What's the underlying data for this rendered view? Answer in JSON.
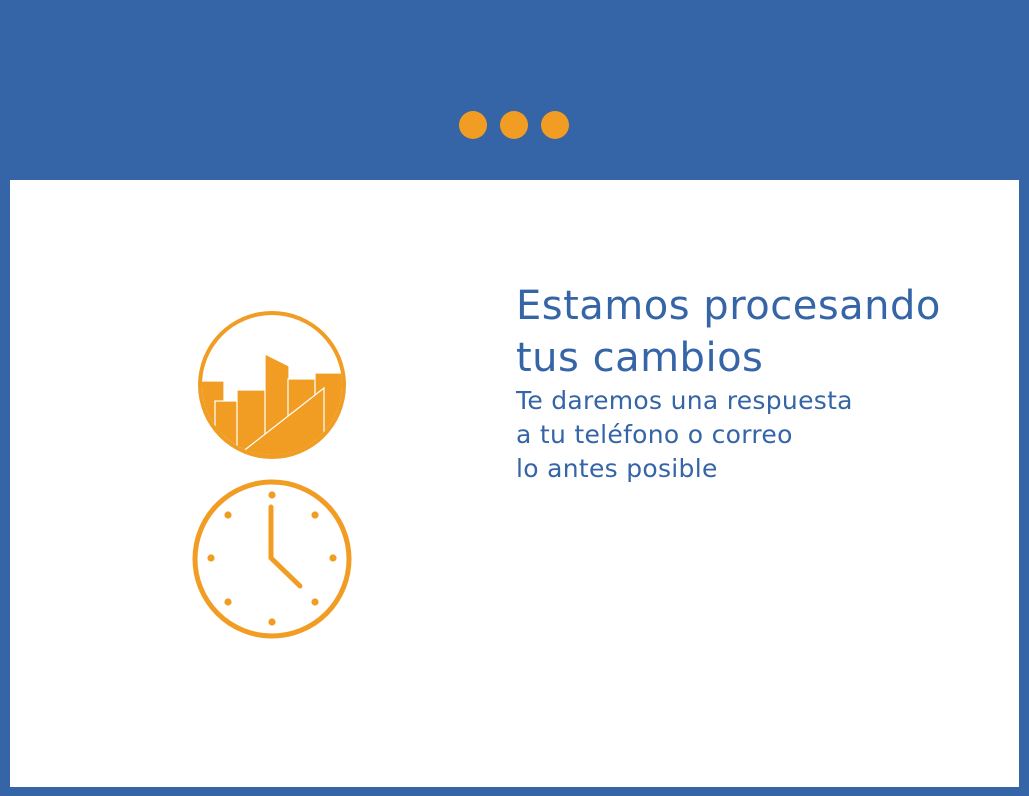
{
  "window": {
    "titlebar_dots": [
      "dot-1",
      "dot-2",
      "dot-3"
    ]
  },
  "message": {
    "headline_lines": [
      "Estamos procesando",
      "tus cambios"
    ],
    "body_lines": [
      "Te daremos una respuesta",
      "a tu teléfono o correo",
      "lo antes posible"
    ]
  },
  "icons": {
    "top": "city-skyline-icon",
    "bottom": "clock-icon"
  },
  "colors": {
    "frame": "#3564a7",
    "accent": "#f19d23",
    "panel": "#ffffff",
    "text": "#3564a7"
  }
}
